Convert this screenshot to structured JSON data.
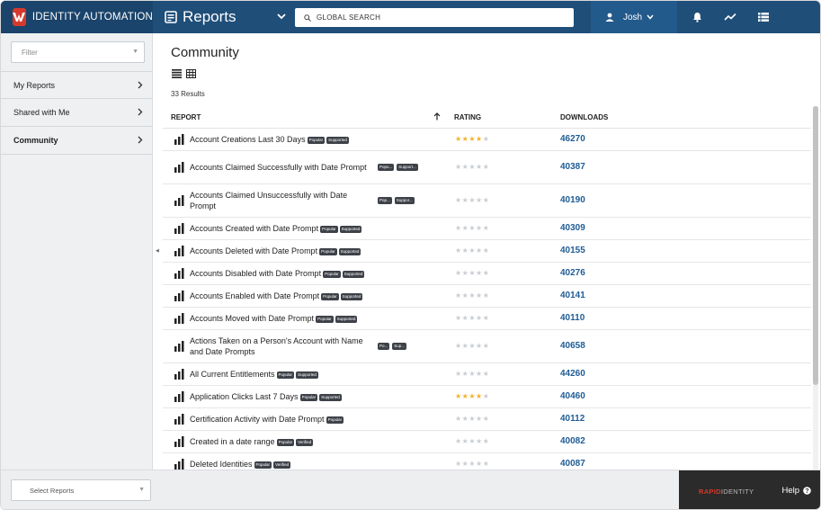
{
  "header": {
    "brand": "IDENTITY AUTOMATION",
    "module_title": "Reports",
    "search_placeholder": "GLOBAL SEARCH",
    "user_name": "Josh"
  },
  "sidebar": {
    "filter_placeholder": "Filter",
    "items": [
      {
        "label": "My Reports"
      },
      {
        "label": "Shared with Me"
      },
      {
        "label": "Community",
        "active": true
      }
    ]
  },
  "main": {
    "title": "Community",
    "results_count": "33 Results",
    "columns": {
      "report": "REPORT",
      "rating": "RATING",
      "downloads": "DOWNLOADS"
    },
    "rows": [
      {
        "name": "Account Creations Last 30 Days",
        "badges": [
          "Popular",
          "Supported"
        ],
        "rating": 4,
        "downloads": "46270"
      },
      {
        "name": "Accounts Claimed Successfully with Date Prompt",
        "badges": [
          "Popu...",
          "Support..."
        ],
        "rating": 0,
        "downloads": "40387"
      },
      {
        "name": "Accounts Claimed Unsuccessfully with Date Prompt",
        "badges": [
          "Pop...",
          "Suppor..."
        ],
        "rating": 0,
        "downloads": "40190"
      },
      {
        "name": "Accounts Created with Date Prompt",
        "badges": [
          "Popular",
          "Supported"
        ],
        "rating": 0,
        "downloads": "40309"
      },
      {
        "name": "Accounts Deleted with Date Prompt",
        "badges": [
          "Popular",
          "Supported"
        ],
        "rating": 0,
        "downloads": "40155"
      },
      {
        "name": "Accounts Disabled with Date Prompt",
        "badges": [
          "Popular",
          "Supported"
        ],
        "rating": 0,
        "downloads": "40276"
      },
      {
        "name": "Accounts Enabled with Date Prompt",
        "badges": [
          "Popular",
          "Supported"
        ],
        "rating": 0,
        "downloads": "40141"
      },
      {
        "name": "Accounts Moved with Date Prompt",
        "badges": [
          "Popular",
          "Supported"
        ],
        "rating": 0,
        "downloads": "40110"
      },
      {
        "name": "Actions Taken on a Person's Account with Name and Date Prompts",
        "badges": [
          "Po...",
          "Sup..."
        ],
        "rating": 0,
        "downloads": "40658"
      },
      {
        "name": "All Current Entitlements",
        "badges": [
          "Popular",
          "Supported"
        ],
        "rating": 0,
        "downloads": "44260"
      },
      {
        "name": "Application Clicks Last 7 Days",
        "badges": [
          "Popular",
          "Supported"
        ],
        "rating": 4,
        "downloads": "40460"
      },
      {
        "name": "Certification Activity with Date Prompt",
        "badges": [
          "Popular"
        ],
        "rating": 0,
        "downloads": "40112"
      },
      {
        "name": "Created in a date range",
        "badges": [
          "Popular",
          "Verified"
        ],
        "rating": 0,
        "downloads": "40082"
      },
      {
        "name": "Deleted Identities",
        "badges": [
          "Popular",
          "Verified"
        ],
        "rating": 0,
        "downloads": "40087"
      }
    ]
  },
  "footer": {
    "select_reports_placeholder": "Select Reports",
    "brand_part1": "RAPID",
    "brand_part2": "IDENTITY",
    "help_label": "Help"
  },
  "colors": {
    "topbar": "#1f4e79",
    "accent_red": "#d7392c",
    "link_blue": "#1f5c95",
    "star_on": "#f2b22d",
    "badge_bg": "#3d4148"
  }
}
